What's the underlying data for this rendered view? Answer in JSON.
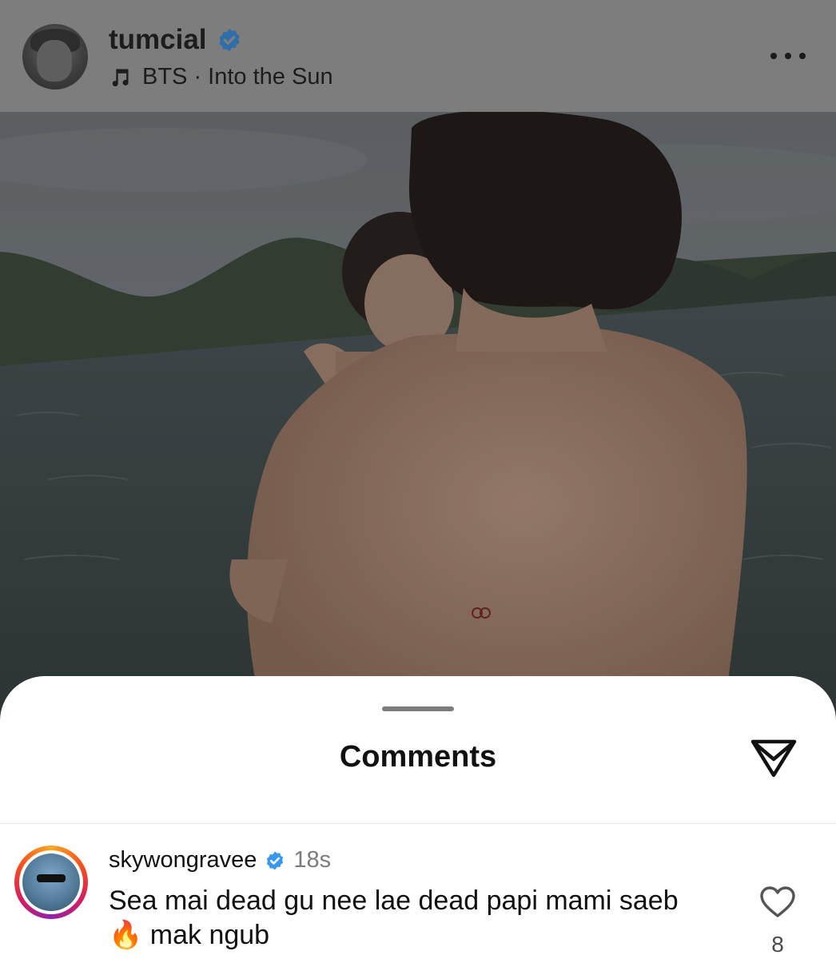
{
  "post": {
    "username": "tumcial",
    "verified": true,
    "music": "BTS · Into the Sun",
    "more_label": "More options"
  },
  "comments_sheet": {
    "title": "Comments",
    "comments": [
      {
        "username": "skywongravee",
        "verified": true,
        "time": "18s",
        "text": "Sea mai dead gu nee lae dead papi mami saeb🔥 mak ngub",
        "likes": "8"
      }
    ]
  },
  "icons": {
    "verified": "verified-badge-icon",
    "music": "music-note-icon",
    "more": "more-options-icon",
    "share": "send-icon",
    "like": "heart-icon"
  },
  "colors": {
    "verified_blue": "#3897f0",
    "sheet_bg": "#ffffff"
  }
}
